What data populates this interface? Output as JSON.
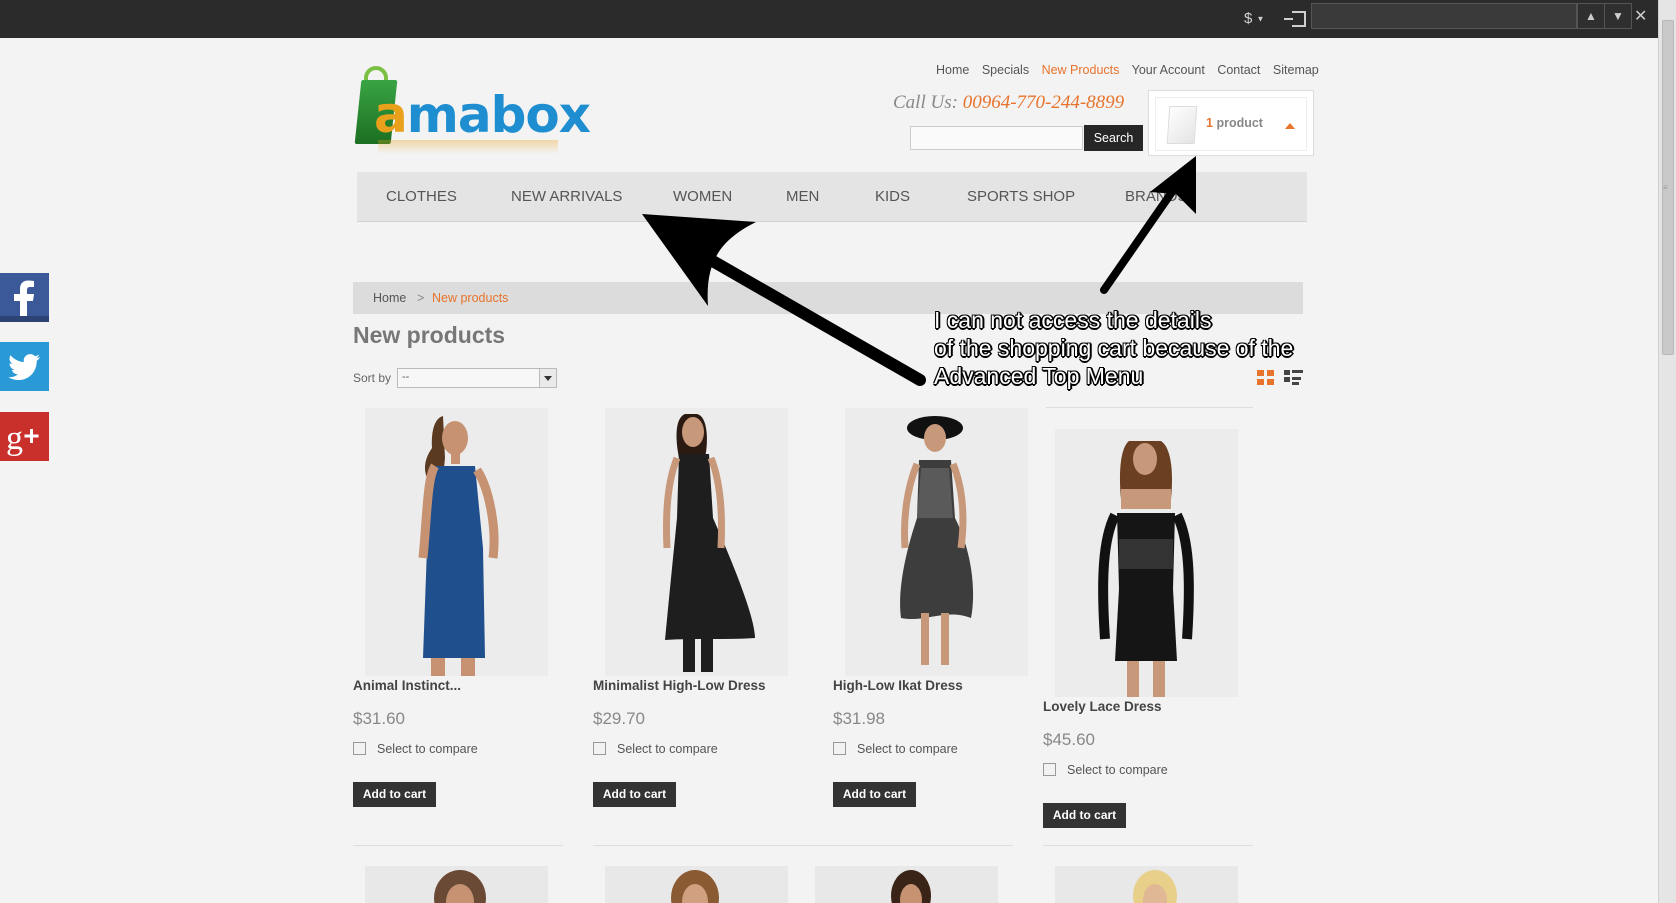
{
  "topbar": {
    "currency": "$",
    "find_prev_label": "▲",
    "find_next_label": "▼",
    "find_close_label": "✕"
  },
  "header": {
    "logo_text_a": "a",
    "logo_text_rest": "mabox",
    "links": [
      "Home",
      "Specials",
      "New Products",
      "Your Account",
      "Contact",
      "Sitemap"
    ],
    "active_link": "New Products",
    "call_label": "Call Us:",
    "phone": "00964-770-244-8899",
    "search_button": "Search",
    "cart_count": "1",
    "cart_label": "product"
  },
  "menu": [
    "CLOTHES",
    "NEW ARRIVALS",
    "WOMEN",
    "MEN",
    "KIDS",
    "SPORTS SHOP",
    "BRANDS"
  ],
  "breadcrumb": {
    "home": "Home",
    "sep": ">",
    "current": "New products"
  },
  "page_title": "New products",
  "sort": {
    "label": "Sort by",
    "value": "--"
  },
  "products": [
    {
      "name": "Animal Instinct...",
      "price": "$31.60",
      "compare": "Select to compare",
      "cart": "Add to cart",
      "dress_color": "#1f4f8c"
    },
    {
      "name": "Minimalist High-Low Dress",
      "price": "$29.70",
      "compare": "Select to compare",
      "cart": "Add to cart",
      "dress_color": "#1e1e1e"
    },
    {
      "name": "High-Low Ikat Dress",
      "price": "$31.98",
      "compare": "Select to compare",
      "cart": "Add to cart",
      "dress_color": "#3d3d3d"
    },
    {
      "name": "Lovely Lace Dress",
      "price": "$45.60",
      "compare": "Select to compare",
      "cart": "Add to cart",
      "dress_color": "#151515"
    }
  ],
  "annotation": {
    "lines": [
      "I can not access the details",
      "of the shopping cart because of the",
      "Advanced Top Menu"
    ]
  },
  "colors": {
    "accent": "#e8732c",
    "facebook": "#3b5998",
    "twitter": "#2a9ad6",
    "googleplus": "#c9302c"
  },
  "icons": {
    "social": [
      "facebook-icon",
      "twitter-icon",
      "google-plus-icon"
    ],
    "views": [
      "grid-view-icon",
      "list-view-icon"
    ]
  }
}
